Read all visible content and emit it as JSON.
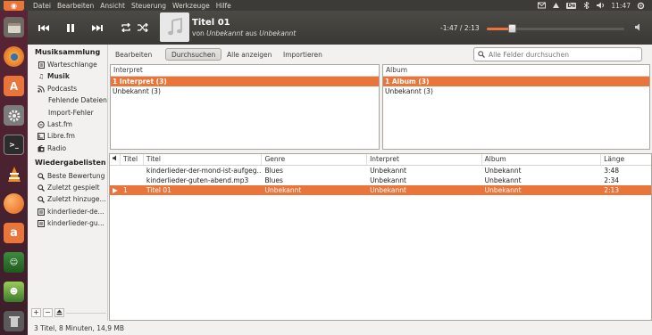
{
  "menubar": {
    "menus": [
      "Datei",
      "Bearbeiten",
      "Ansicht",
      "Steuerung",
      "Werkzeuge",
      "Hilfe"
    ],
    "clock": "11:47",
    "lang_badge": "De"
  },
  "player": {
    "title": "Titel 01",
    "by_word": "von",
    "artist": "Unbekannt",
    "from_word": "aus",
    "album": "Unbekannt",
    "time": "-1:47 / 2:13",
    "progress": 0.18
  },
  "sidebar": {
    "library_header": "Musiksammlung",
    "library_items": [
      {
        "label": "Warteschlange",
        "icon": "queue-icon"
      },
      {
        "label": "Musik",
        "icon": "music-note-icon"
      },
      {
        "label": "Podcasts",
        "icon": "rss-icon"
      },
      {
        "label": "Fehlende Dateien",
        "icon": ""
      },
      {
        "label": "Import-Fehler",
        "icon": ""
      },
      {
        "label": "Last.fm",
        "icon": "lastfm-icon"
      },
      {
        "label": "Libre.fm",
        "icon": "librefm-icon"
      },
      {
        "label": "Radio",
        "icon": "radio-icon"
      }
    ],
    "playlists_header": "Wiedergabelisten",
    "playlists": [
      {
        "label": "Beste Bewertung"
      },
      {
        "label": "Zuletzt gespielt"
      },
      {
        "label": "Zuletzt hinzuge..."
      },
      {
        "label": "kinderlieder-de..."
      },
      {
        "label": "kinderlieder-gu..."
      }
    ]
  },
  "toolbar": {
    "tabs": [
      "Bearbeiten",
      "Durchsuchen",
      "Alle anzeigen",
      "Importieren"
    ],
    "active_tab": "Durchsuchen",
    "search_placeholder": "Alle Felder durchsuchen"
  },
  "browser": {
    "artist_header": "Interpret",
    "artist_rows": [
      "1 Interpret (3)",
      "Unbekannt (3)"
    ],
    "album_header": "Album",
    "album_rows": [
      "1 Album (3)",
      "Unbekannt (3)"
    ]
  },
  "tracklist": {
    "headers": [
      "",
      "Titel",
      "Titel",
      "Genre",
      "Interpret",
      "Album",
      "Länge"
    ],
    "rows": [
      {
        "playing": "",
        "num": "",
        "title": "kinderlieder-der-mond-ist-aufgeg...",
        "genre": "Blues",
        "artist": "Unbekannt",
        "album": "Unbekannt",
        "length": "3:48"
      },
      {
        "playing": "",
        "num": "",
        "title": "kinderlieder-guten-abend.mp3",
        "genre": "Blues",
        "artist": "Unbekannt",
        "album": "Unbekannt",
        "length": "2:34"
      },
      {
        "playing": "▶",
        "num": "1",
        "title": "Titel 01",
        "genre": "Unbekannt",
        "artist": "Unbekannt",
        "album": "Unbekannt",
        "length": "2:13"
      }
    ]
  },
  "status": "3 Titel, 8 Minuten, 14,9 MB",
  "colors": {
    "accent": "#e9753a",
    "launcher": "#4a2232",
    "header": "#3c3b37"
  }
}
